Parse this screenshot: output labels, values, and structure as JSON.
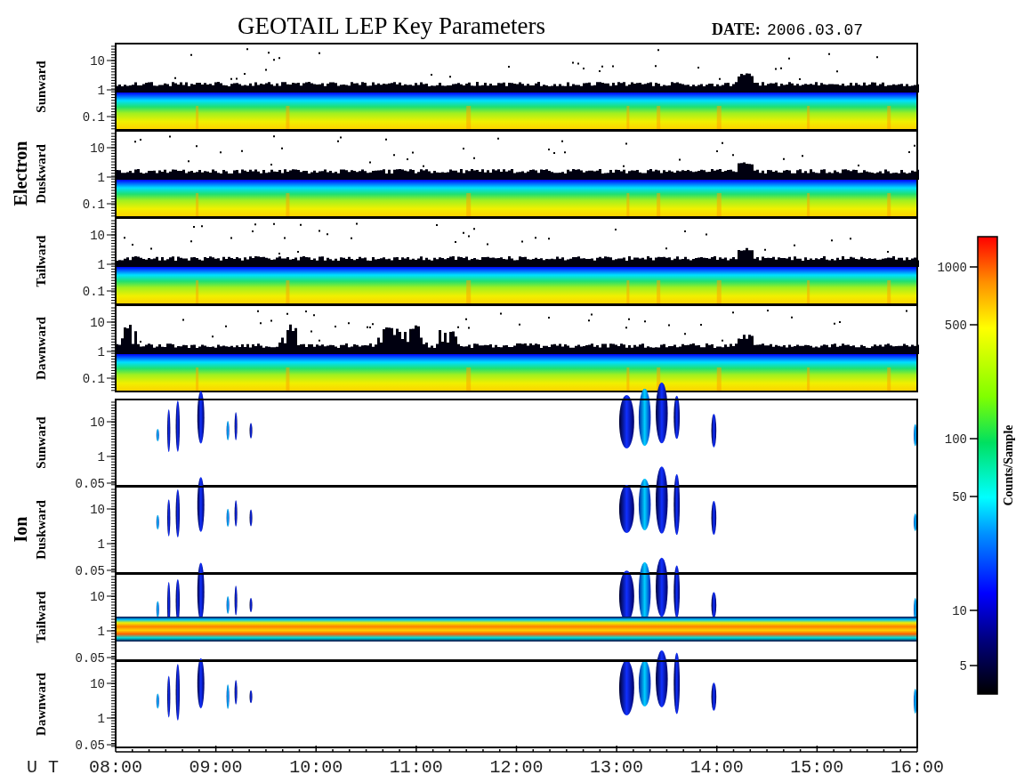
{
  "title": "GEOTAIL LEP Key Parameters",
  "date": {
    "label": "DATE:",
    "value": "2006.03.07"
  },
  "groups": [
    {
      "name": "Electron",
      "kind": "electron",
      "panels": [
        {
          "label": "Sunward",
          "kind": "electron",
          "yticks": [
            "10",
            "1",
            "0.1"
          ]
        },
        {
          "label": "Duskward",
          "kind": "electron",
          "yticks": [
            "10",
            "1",
            "0.1"
          ]
        },
        {
          "label": "Tailward",
          "kind": "electron",
          "yticks": [
            "10",
            "1",
            "0.1"
          ]
        },
        {
          "label": "Dawnward",
          "kind": "electron",
          "yticks": [
            "10",
            "1",
            "0.1"
          ]
        }
      ]
    },
    {
      "name": "Ion",
      "kind": "ion",
      "panels": [
        {
          "label": "Sunward",
          "kind": "beams",
          "yticks": [
            "10",
            "1",
            "0.05"
          ]
        },
        {
          "label": "Duskward",
          "kind": "beams",
          "yticks": [
            "10",
            "1",
            "0.05"
          ]
        },
        {
          "label": "Tailward",
          "kind": "band",
          "yticks": [
            "10",
            "1",
            "0.05"
          ]
        },
        {
          "label": "Dawnward",
          "kind": "beams",
          "yticks": [
            "10",
            "1",
            "0.05"
          ]
        }
      ]
    }
  ],
  "x_axis": {
    "label": "U T",
    "ticks": [
      "08:00",
      "09:00",
      "10:00",
      "11:00",
      "12:00",
      "13:00",
      "14:00",
      "15:00",
      "16:00"
    ]
  },
  "colorbar": {
    "label": "Counts/Sample",
    "ticks": [
      "1000",
      "500",
      "100",
      "50",
      "10",
      "5"
    ]
  }
}
